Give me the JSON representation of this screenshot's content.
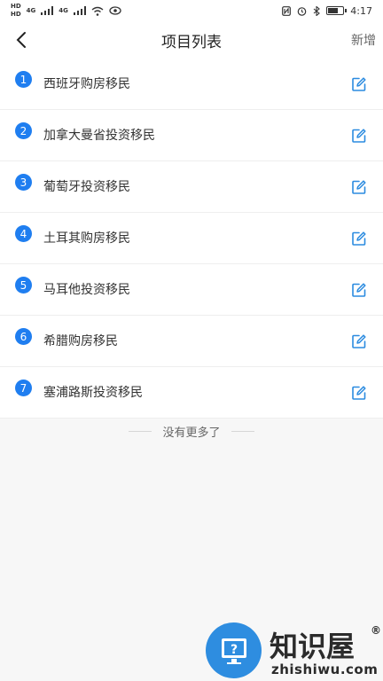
{
  "status_bar": {
    "sim1": "HD",
    "sim2": "HD",
    "net1": "4G",
    "net2": "4G",
    "time": "4:17",
    "battery_level": 0.7
  },
  "header": {
    "title": "项目列表",
    "action_label": "新增",
    "back_icon": "chevron-left-icon"
  },
  "projects": [
    {
      "index": "1",
      "name": "西班牙购房移民"
    },
    {
      "index": "2",
      "name": "加拿大曼省投资移民"
    },
    {
      "index": "3",
      "name": "葡萄牙投资移民"
    },
    {
      "index": "4",
      "name": "土耳其购房移民"
    },
    {
      "index": "5",
      "name": "马耳他投资移民"
    },
    {
      "index": "6",
      "name": "希腊购房移民"
    },
    {
      "index": "7",
      "name": "塞浦路斯投资移民"
    }
  ],
  "footer": {
    "no_more_text": "没有更多了"
  },
  "watermark": {
    "brand": "知识屋",
    "url": "zhishiwu.com",
    "reg_mark": "®"
  },
  "colors": {
    "accent": "#1f7ef0",
    "edit_icon": "#2b8be0",
    "background": "#f7f7f7"
  }
}
